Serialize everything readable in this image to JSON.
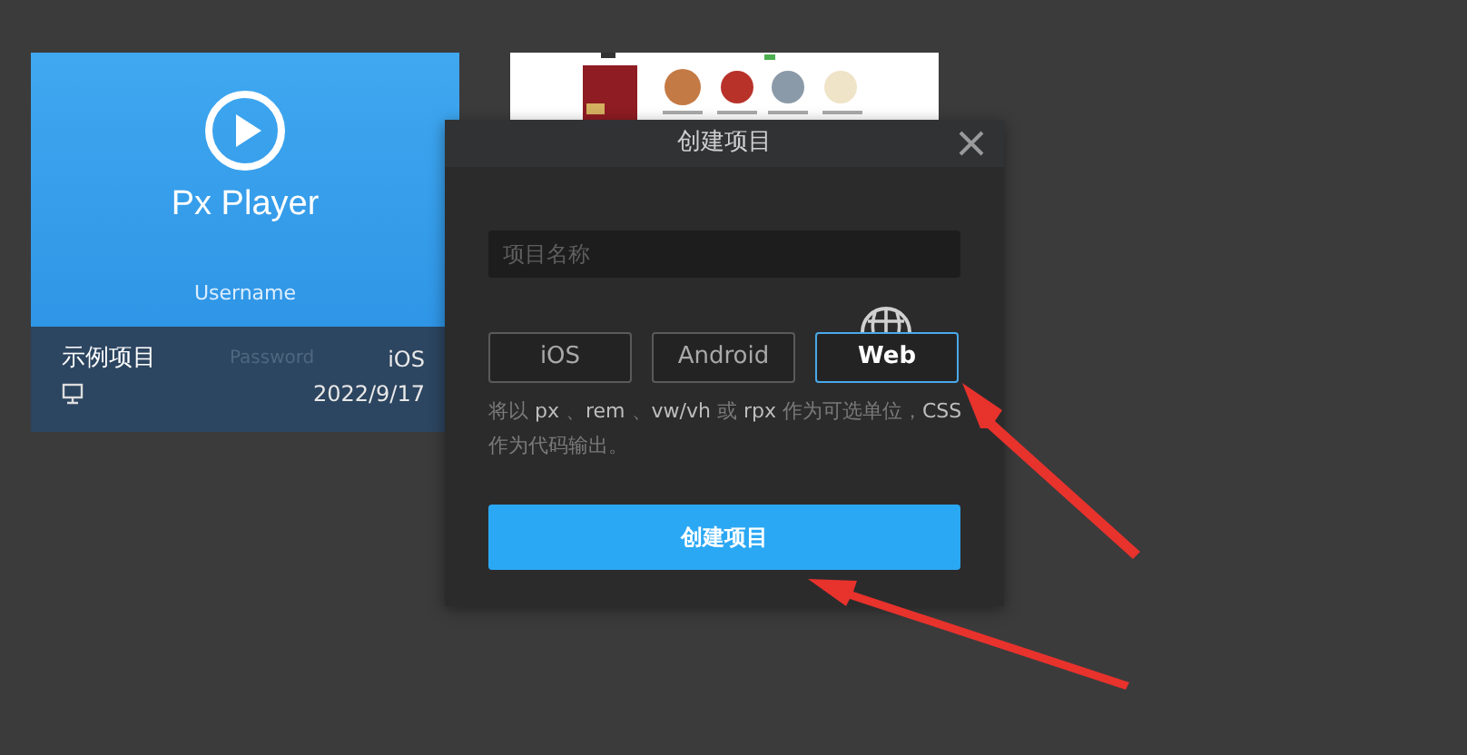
{
  "projects": [
    {
      "kind": "demo",
      "logo": "Px Player",
      "username_label": "Username",
      "password_label": "Password",
      "name": "示例项目",
      "platform": "iOS",
      "date": "2022/9/17"
    },
    {
      "kind": "picture"
    }
  ],
  "dialog": {
    "title": "创建项目",
    "name_field": {
      "placeholder": "项目名称"
    },
    "platforms": [
      {
        "label": "iOS",
        "selected": false
      },
      {
        "label": "Android",
        "selected": false
      },
      {
        "label": "Web",
        "selected": true
      }
    ],
    "hint": "将以 **px** 、**rem** 、**vw/vh** 或 **rpx** 作为可选单位，**CSS** 作为代码输出。",
    "create_button": "创建项目"
  }
}
